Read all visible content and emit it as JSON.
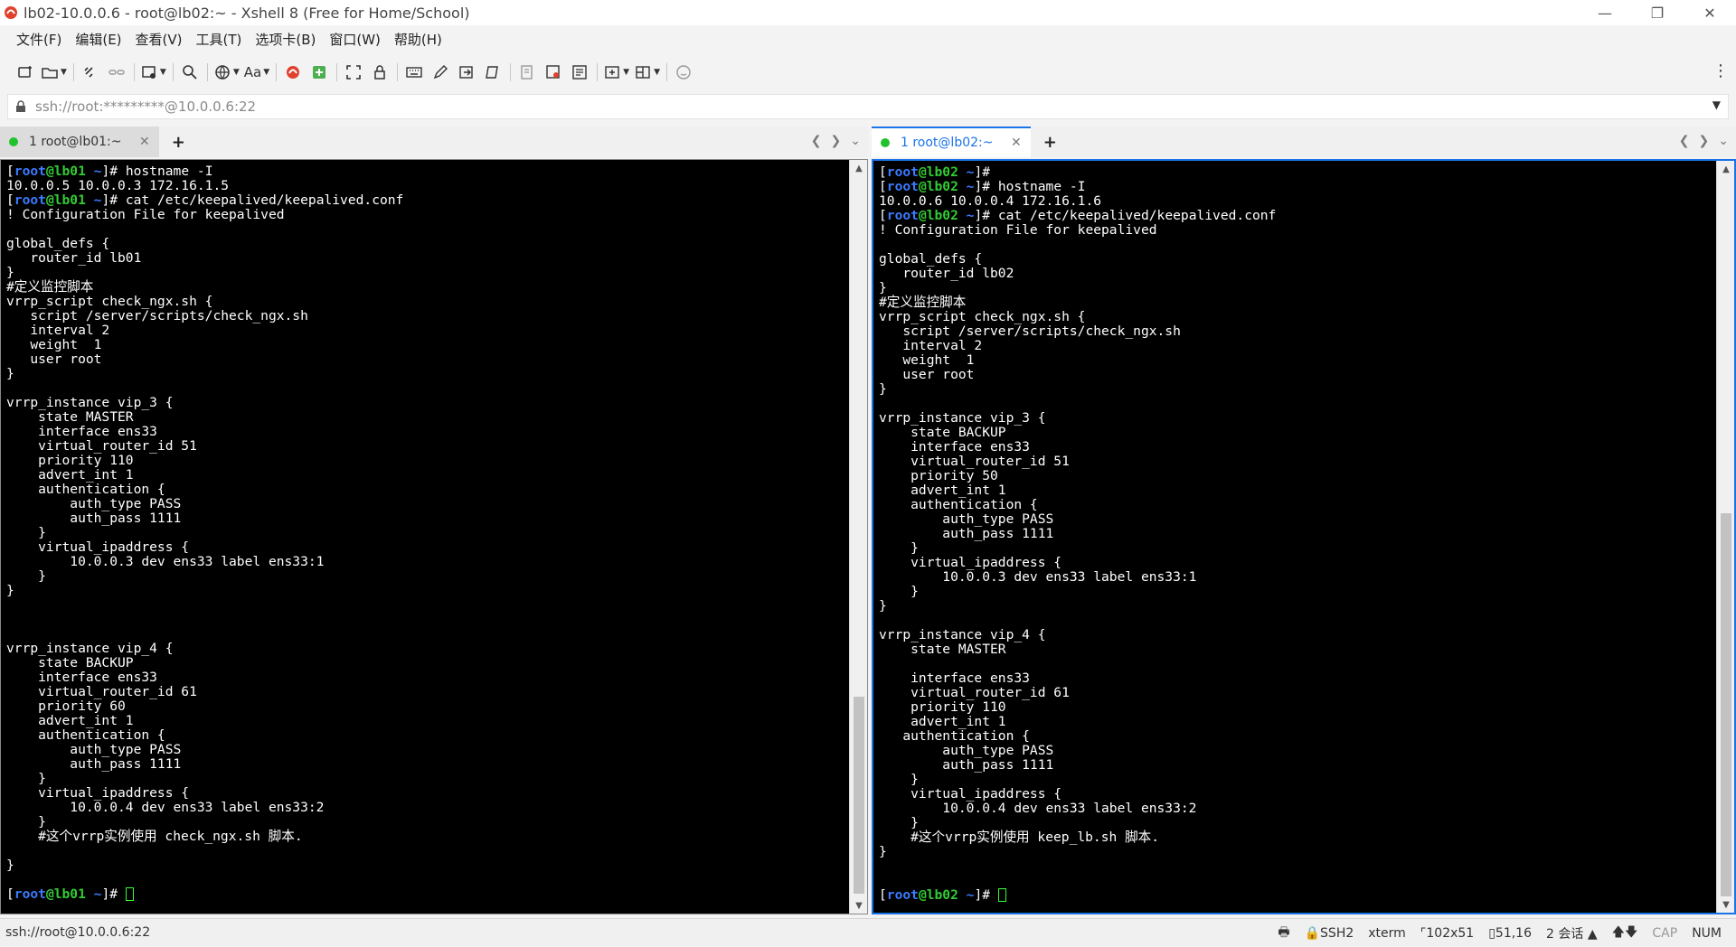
{
  "window": {
    "title": "lb02-10.0.0.6 - root@lb02:~ - Xshell 8 (Free for Home/School)",
    "controls": [
      "minimize-icon",
      "restore-icon",
      "close-icon"
    ]
  },
  "menu": [
    "文件(F)",
    "编辑(E)",
    "查看(V)",
    "工具(T)",
    "选项卡(B)",
    "窗口(W)",
    "帮助(H)"
  ],
  "toolbar": {
    "font_button_label": "Aa"
  },
  "address": {
    "value": "ssh://root:*********@10.0.0.6:22"
  },
  "left_pane": {
    "tab_label": "1 root@lb01:~",
    "prompt": {
      "user": "root",
      "at": "@",
      "host": "lb01",
      "dir": "~"
    },
    "lines": [
      {
        "prompt": true,
        "text": "hostname -I"
      },
      {
        "text": "10.0.0.5 10.0.0.3 172.16.1.5"
      },
      {
        "prompt": true,
        "text": "cat /etc/keepalived/keepalived.conf"
      },
      {
        "text": "! Configuration File for keepalived"
      },
      {
        "text": ""
      },
      {
        "text": "global_defs {"
      },
      {
        "text": "   router_id lb01"
      },
      {
        "text": "}"
      },
      {
        "text": "#定义监控脚本"
      },
      {
        "text": "vrrp_script check_ngx.sh {"
      },
      {
        "text": "   script /server/scripts/check_ngx.sh"
      },
      {
        "text": "   interval 2"
      },
      {
        "text": "   weight  1"
      },
      {
        "text": "   user root"
      },
      {
        "text": "}"
      },
      {
        "text": ""
      },
      {
        "text": "vrrp_instance vip_3 {"
      },
      {
        "text": "    state MASTER"
      },
      {
        "text": "    interface ens33"
      },
      {
        "text": "    virtual_router_id 51"
      },
      {
        "text": "    priority 110"
      },
      {
        "text": "    advert_int 1"
      },
      {
        "text": "    authentication {"
      },
      {
        "text": "        auth_type PASS"
      },
      {
        "text": "        auth_pass 1111"
      },
      {
        "text": "    }"
      },
      {
        "text": "    virtual_ipaddress {"
      },
      {
        "text": "        10.0.0.3 dev ens33 label ens33:1"
      },
      {
        "text": "    }"
      },
      {
        "text": "}"
      },
      {
        "text": ""
      },
      {
        "text": ""
      },
      {
        "text": ""
      },
      {
        "text": "vrrp_instance vip_4 {"
      },
      {
        "text": "    state BACKUP"
      },
      {
        "text": "    interface ens33"
      },
      {
        "text": "    virtual_router_id 61"
      },
      {
        "text": "    priority 60"
      },
      {
        "text": "    advert_int 1"
      },
      {
        "text": "    authentication {"
      },
      {
        "text": "        auth_type PASS"
      },
      {
        "text": "        auth_pass 1111"
      },
      {
        "text": "    }"
      },
      {
        "text": "    virtual_ipaddress {"
      },
      {
        "text": "        10.0.0.4 dev ens33 label ens33:2"
      },
      {
        "text": "    }"
      },
      {
        "text": "    #这个vrrp实例使用 check_ngx.sh 脚本."
      },
      {
        "text": ""
      },
      {
        "text": "}"
      },
      {
        "text": ""
      },
      {
        "prompt": true,
        "text": "",
        "cursor": true
      }
    ]
  },
  "right_pane": {
    "tab_label": "1 root@lb02:~",
    "prompt": {
      "user": "root",
      "at": "@",
      "host": "lb02",
      "dir": "~"
    },
    "lines": [
      {
        "prompt": true,
        "text": ""
      },
      {
        "prompt": true,
        "text": "hostname -I"
      },
      {
        "text": "10.0.0.6 10.0.0.4 172.16.1.6"
      },
      {
        "prompt": true,
        "text": "cat /etc/keepalived/keepalived.conf"
      },
      {
        "text": "! Configuration File for keepalived"
      },
      {
        "text": ""
      },
      {
        "text": "global_defs {"
      },
      {
        "text": "   router_id lb02"
      },
      {
        "text": "}"
      },
      {
        "text": "#定义监控脚本"
      },
      {
        "text": "vrrp_script check_ngx.sh {"
      },
      {
        "text": "   script /server/scripts/check_ngx.sh"
      },
      {
        "text": "   interval 2"
      },
      {
        "text": "   weight  1"
      },
      {
        "text": "   user root"
      },
      {
        "text": "}"
      },
      {
        "text": ""
      },
      {
        "text": "vrrp_instance vip_3 {"
      },
      {
        "text": "    state BACKUP"
      },
      {
        "text": "    interface ens33"
      },
      {
        "text": "    virtual_router_id 51"
      },
      {
        "text": "    priority 50"
      },
      {
        "text": "    advert_int 1"
      },
      {
        "text": "    authentication {"
      },
      {
        "text": "        auth_type PASS"
      },
      {
        "text": "        auth_pass 1111"
      },
      {
        "text": "    }"
      },
      {
        "text": "    virtual_ipaddress {"
      },
      {
        "text": "        10.0.0.3 dev ens33 label ens33:1"
      },
      {
        "text": "    }"
      },
      {
        "text": "}"
      },
      {
        "text": ""
      },
      {
        "text": "vrrp_instance vip_4 {"
      },
      {
        "text": "    state MASTER"
      },
      {
        "text": ""
      },
      {
        "text": "    interface ens33"
      },
      {
        "text": "    virtual_router_id 61"
      },
      {
        "text": "    priority 110"
      },
      {
        "text": "    advert_int 1"
      },
      {
        "text": "   authentication {"
      },
      {
        "text": "        auth_type PASS"
      },
      {
        "text": "        auth_pass 1111"
      },
      {
        "text": "    }"
      },
      {
        "text": "    virtual_ipaddress {"
      },
      {
        "text": "        10.0.0.4 dev ens33 label ens33:2"
      },
      {
        "text": "    }"
      },
      {
        "text": "    #这个vrrp实例使用 keep_lb.sh 脚本."
      },
      {
        "text": "}"
      },
      {
        "text": ""
      },
      {
        "text": ""
      },
      {
        "prompt": true,
        "text": "",
        "cursor": true
      }
    ]
  },
  "status": {
    "connection": "ssh://root@10.0.0.6:22",
    "protocol": "SSH2",
    "terminal_type": "xterm",
    "size": "102x51",
    "cursor_pos": "51,16",
    "sessions": "2 会话",
    "caps": "CAP",
    "num": "NUM"
  }
}
